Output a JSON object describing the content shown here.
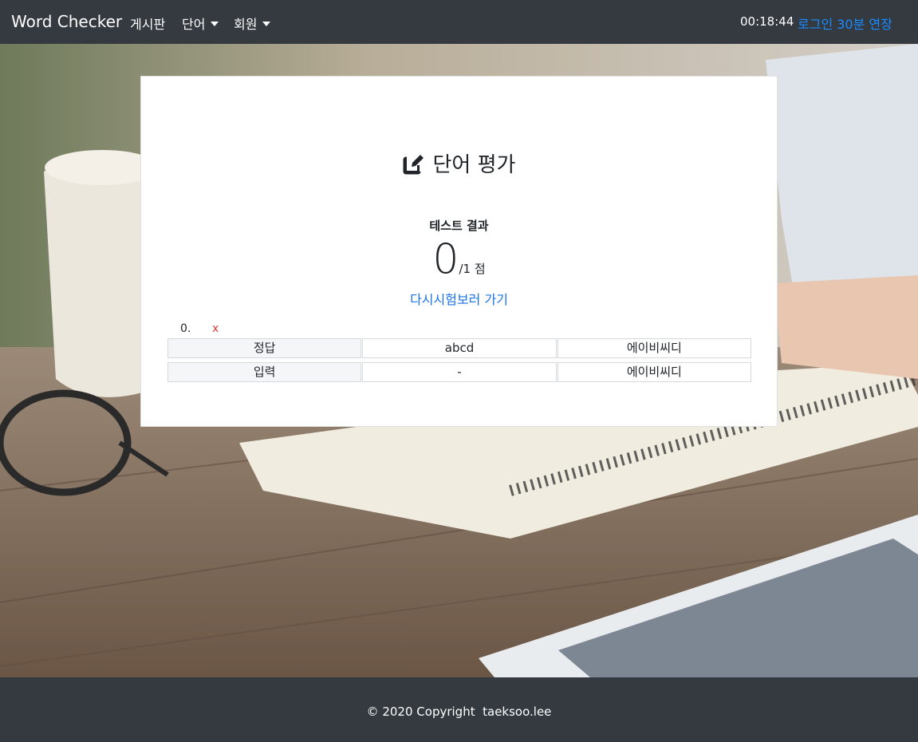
{
  "navbar": {
    "brand": "Word Checker",
    "menu": [
      {
        "label": "게시판"
      },
      {
        "label": "단어"
      },
      {
        "label": "회원"
      }
    ],
    "timer": "00:18:44",
    "extend_label": "로그인 30분 연장"
  },
  "card": {
    "title": "단어 평가",
    "title_icon": "edit-icon",
    "result_label": "테스트 결과",
    "score": "0",
    "score_total": "/1 점",
    "retry_link": "다시시험보러 가기",
    "question": {
      "number": "0.",
      "mark": "x",
      "mark_color": "#e03c3c"
    },
    "rows": [
      {
        "header": "정답",
        "word": "abcd",
        "meaning": "에이비씨디"
      },
      {
        "header": "입력",
        "word": "-",
        "meaning": "에이비씨디"
      }
    ]
  },
  "footer": {
    "text": "© 2020 Copyright  taeksoo.lee"
  },
  "colors": {
    "navbar_bg": "#343a40",
    "link": "#1a73e8",
    "extend_link": "#1a8cff",
    "wrong_mark": "#e03c3c"
  }
}
